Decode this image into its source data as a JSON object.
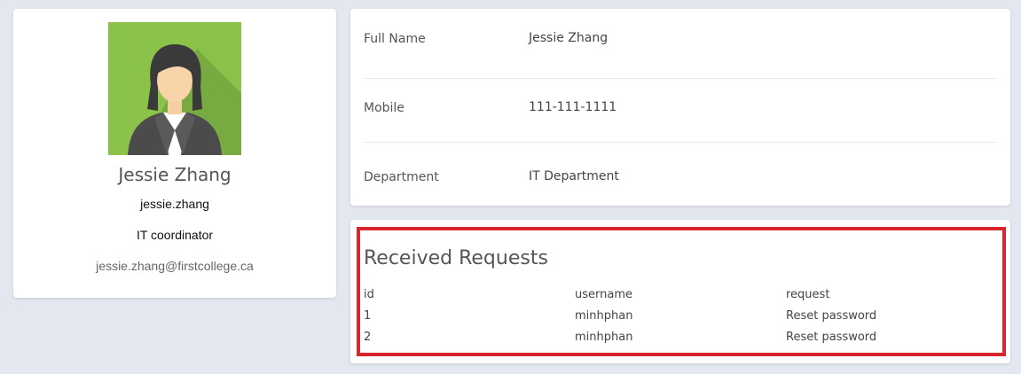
{
  "profile": {
    "avatar": "user-avatar-female-icon",
    "name": "Jessie Zhang",
    "username": "jessie.zhang",
    "title": "IT coordinator",
    "email": "jessie.zhang@firstcollege.ca"
  },
  "details": [
    {
      "label": "Full Name",
      "value": "Jessie Zhang"
    },
    {
      "label": "Mobile",
      "value": "111-111-1111"
    },
    {
      "label": "Department",
      "value": "IT Department"
    }
  ],
  "requests": {
    "title": "Received Requests",
    "columns": [
      "id",
      "username",
      "request"
    ],
    "rows": [
      {
        "id": "1",
        "username": "minhphan",
        "request": "Reset password"
      },
      {
        "id": "2",
        "username": "minhphan",
        "request": "Reset password"
      }
    ]
  },
  "colors": {
    "background": "#e3e8f0",
    "highlight": "#d9252e",
    "avatar_bg": "#8bc34a"
  }
}
